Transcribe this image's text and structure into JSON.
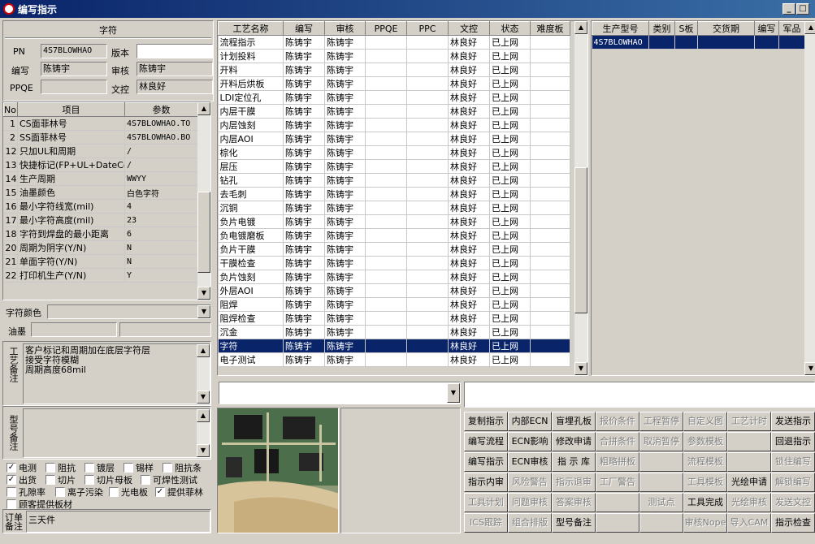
{
  "window": {
    "title": "编写指示",
    "min": "_",
    "max": "□",
    "close": "×"
  },
  "char_section": {
    "header": "字符",
    "pn_label": "PN",
    "pn_value": "4S7BLOWHAO",
    "version_label": "版本",
    "version_value": "",
    "writer_label": "编写",
    "writer_value": "陈铸宇",
    "reviewer_label": "审核",
    "reviewer_value": "陈铸宇",
    "ppqe_label": "PPQE",
    "ppqe_value": "",
    "wenkong_label": "文控",
    "wenkong_value": "林良好"
  },
  "param_table": {
    "headers": [
      "No",
      "项目",
      "参数"
    ],
    "rows": [
      [
        "1",
        "CS面菲林号",
        "4S7BLOWHAO.TO"
      ],
      [
        "2",
        "SS面菲林号",
        "4S7BLOWHAO.BO"
      ],
      [
        "12",
        "只加UL和周期",
        "/"
      ],
      [
        "13",
        "快捷标记(FP+UL+DateCo",
        "/"
      ],
      [
        "14",
        "生产周期",
        "WWYY"
      ],
      [
        "15",
        "油墨颜色",
        "白色字符"
      ],
      [
        "16",
        "最小字符线宽(mil)",
        "4"
      ],
      [
        "17",
        "最小字符高度(mil)",
        "23"
      ],
      [
        "18",
        "字符到焊盘的最小距离",
        "6"
      ],
      [
        "20",
        "周期为阴字(Y/N)",
        "N"
      ],
      [
        "21",
        "单面字符(Y/N)",
        "N"
      ],
      [
        "22",
        "打印机生产(Y/N)",
        "Y"
      ]
    ]
  },
  "char_color_label": "字符颜色",
  "ink_label": "油墨",
  "process_note": {
    "label": "工艺备注",
    "text": "客户标记和周期加在底层字符层\n接受字符模糊\n周期高度68mil"
  },
  "model_note": {
    "label": "型号备注",
    "text": ""
  },
  "checkboxes": [
    {
      "label": "电测",
      "checked": true
    },
    {
      "label": "阻抗",
      "checked": false
    },
    {
      "label": "镀层",
      "checked": false
    },
    {
      "label": "锡样",
      "checked": false
    },
    {
      "label": "阻抗条",
      "checked": false
    },
    {
      "label": "出货",
      "checked": true
    },
    {
      "label": "切片",
      "checked": false
    },
    {
      "label": "切片母板",
      "checked": false
    },
    {
      "label": "可焊性测试",
      "checked": false
    },
    {
      "label": "孔隙率",
      "checked": false
    },
    {
      "label": "离子污染",
      "checked": false
    },
    {
      "label": "光电板",
      "checked": false
    },
    {
      "label": "提供菲林",
      "checked": true
    },
    {
      "label": "顾客提供板材",
      "checked": false
    }
  ],
  "order_note": {
    "label": "订单备注",
    "text": "三天件"
  },
  "process_table": {
    "headers": [
      "工艺名称",
      "编写",
      "审核",
      "PPQE",
      "PPC",
      "文控",
      "状态",
      "难度板"
    ],
    "rows": [
      [
        "流程指示",
        "陈铸宇",
        "陈铸宇",
        "",
        "",
        "林良好",
        "已上网",
        ""
      ],
      [
        "计划投料",
        "陈铸宇",
        "陈铸宇",
        "",
        "",
        "林良好",
        "已上网",
        ""
      ],
      [
        "开料",
        "陈铸宇",
        "陈铸宇",
        "",
        "",
        "林良好",
        "已上网",
        ""
      ],
      [
        "开料后烘板",
        "陈铸宇",
        "陈铸宇",
        "",
        "",
        "林良好",
        "已上网",
        ""
      ],
      [
        "LDI定位孔",
        "陈铸宇",
        "陈铸宇",
        "",
        "",
        "林良好",
        "已上网",
        ""
      ],
      [
        "内层干膜",
        "陈铸宇",
        "陈铸宇",
        "",
        "",
        "林良好",
        "已上网",
        ""
      ],
      [
        "内层蚀刻",
        "陈铸宇",
        "陈铸宇",
        "",
        "",
        "林良好",
        "已上网",
        ""
      ],
      [
        "内层AOI",
        "陈铸宇",
        "陈铸宇",
        "",
        "",
        "林良好",
        "已上网",
        ""
      ],
      [
        "棕化",
        "陈铸宇",
        "陈铸宇",
        "",
        "",
        "林良好",
        "已上网",
        ""
      ],
      [
        "层压",
        "陈铸宇",
        "陈铸宇",
        "",
        "",
        "林良好",
        "已上网",
        ""
      ],
      [
        "钻孔",
        "陈铸宇",
        "陈铸宇",
        "",
        "",
        "林良好",
        "已上网",
        ""
      ],
      [
        "去毛刺",
        "陈铸宇",
        "陈铸宇",
        "",
        "",
        "林良好",
        "已上网",
        ""
      ],
      [
        "沉铜",
        "陈铸宇",
        "陈铸宇",
        "",
        "",
        "林良好",
        "已上网",
        ""
      ],
      [
        "负片电镀",
        "陈铸宇",
        "陈铸宇",
        "",
        "",
        "林良好",
        "已上网",
        ""
      ],
      [
        "负电镀磨板",
        "陈铸宇",
        "陈铸宇",
        "",
        "",
        "林良好",
        "已上网",
        ""
      ],
      [
        "负片干膜",
        "陈铸宇",
        "陈铸宇",
        "",
        "",
        "林良好",
        "已上网",
        ""
      ],
      [
        "干膜检查",
        "陈铸宇",
        "陈铸宇",
        "",
        "",
        "林良好",
        "已上网",
        ""
      ],
      [
        "负片蚀刻",
        "陈铸宇",
        "陈铸宇",
        "",
        "",
        "林良好",
        "已上网",
        ""
      ],
      [
        "外层AOI",
        "陈铸宇",
        "陈铸宇",
        "",
        "",
        "林良好",
        "已上网",
        ""
      ],
      [
        "阻焊",
        "陈铸宇",
        "陈铸宇",
        "",
        "",
        "林良好",
        "已上网",
        ""
      ],
      [
        "阻焊检查",
        "陈铸宇",
        "陈铸宇",
        "",
        "",
        "林良好",
        "已上网",
        ""
      ],
      [
        "沉金",
        "陈铸宇",
        "陈铸宇",
        "",
        "",
        "林良好",
        "已上网",
        ""
      ],
      [
        "字符",
        "陈铸宇",
        "陈铸宇",
        "",
        "",
        "林良好",
        "已上网",
        ""
      ],
      [
        "电子测试",
        "陈铸宇",
        "陈铸宇",
        "",
        "",
        "林良好",
        "已上网",
        ""
      ]
    ],
    "selected_index": 22
  },
  "model_table": {
    "headers": [
      "生产型号",
      "类别",
      "S板",
      "交货期",
      "编写",
      "军品"
    ],
    "rows": [
      [
        "4S7BLOWHAO",
        "",
        "",
        "",
        "",
        ""
      ]
    ]
  },
  "buttons": [
    [
      "复制指示",
      "内部ECN",
      "盲埋孔板",
      "报价条件",
      "工程暂停",
      "自定义图",
      "工艺计时",
      "发送指示"
    ],
    [
      "编写流程",
      "ECN影响",
      "修改申请",
      "合拼条件",
      "取消暂停",
      "参数模板",
      "",
      "回退指示"
    ],
    [
      "编写指示",
      "ECN审核",
      "指 示 库",
      "粗略拼板",
      "",
      "流程模板",
      "",
      "锁住编写"
    ],
    [
      "指示内审",
      "风险警告",
      "指示退审",
      "工厂警告",
      "",
      "工具模板",
      "光绘申请",
      "解锁编写"
    ],
    [
      "工具计划",
      "问题审核",
      "答案审核",
      "",
      "测试点",
      "工具完成",
      "光绘审核",
      "发送文控"
    ],
    [
      "ICS跟踪",
      "组合排版",
      "型号备注",
      "",
      "",
      "审核Nope",
      "导入CAM",
      "指示检查"
    ]
  ],
  "disabled_buttons": [
    [
      false,
      false,
      false,
      true,
      true,
      true,
      true,
      false
    ],
    [
      false,
      false,
      false,
      true,
      true,
      true,
      true,
      false
    ],
    [
      false,
      false,
      false,
      true,
      true,
      true,
      true,
      true
    ],
    [
      false,
      true,
      true,
      true,
      true,
      true,
      false,
      true
    ],
    [
      true,
      true,
      true,
      true,
      true,
      false,
      true,
      true
    ],
    [
      true,
      true,
      false,
      true,
      true,
      true,
      true,
      false
    ]
  ]
}
